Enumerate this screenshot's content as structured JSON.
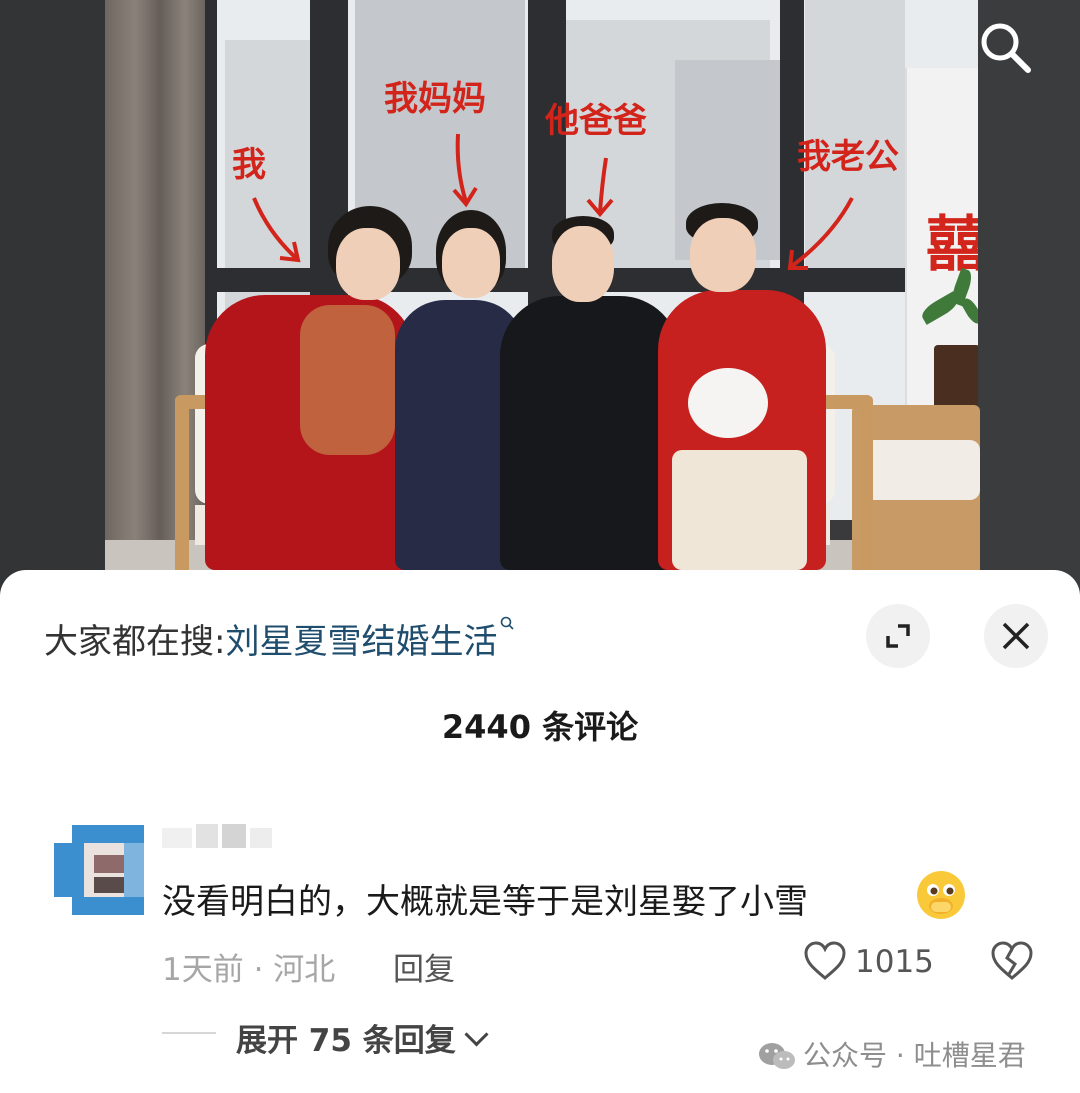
{
  "photo": {
    "labels": {
      "me": "我",
      "my_mom": "我妈妈",
      "his_dad": "他爸爸",
      "my_husband": "我老公"
    },
    "decor_text": "囍"
  },
  "sheet": {
    "hot_search_prefix": "大家都在搜:",
    "hot_search_term": "刘星夏雪结婚生活",
    "comment_count_label": "2440 条评论"
  },
  "comment": {
    "text": "没看明白的，大概就是等于是刘星娶了小雪",
    "emoji": "🫣",
    "meta": "1天前 · 河北",
    "reply_label": "回复",
    "like_count": "1015",
    "expand_replies_label": "展开 75 条回复"
  },
  "watermark": {
    "text": "公众号 · 吐槽星君"
  },
  "colors": {
    "annotation_red": "#d3241b",
    "hot_term_blue": "#1f4d6e"
  },
  "icons": [
    "search-icon",
    "expand-icon",
    "close-icon",
    "search-small-icon",
    "heart-icon",
    "broken-heart-icon",
    "chevron-down-icon",
    "wechat-icon"
  ]
}
